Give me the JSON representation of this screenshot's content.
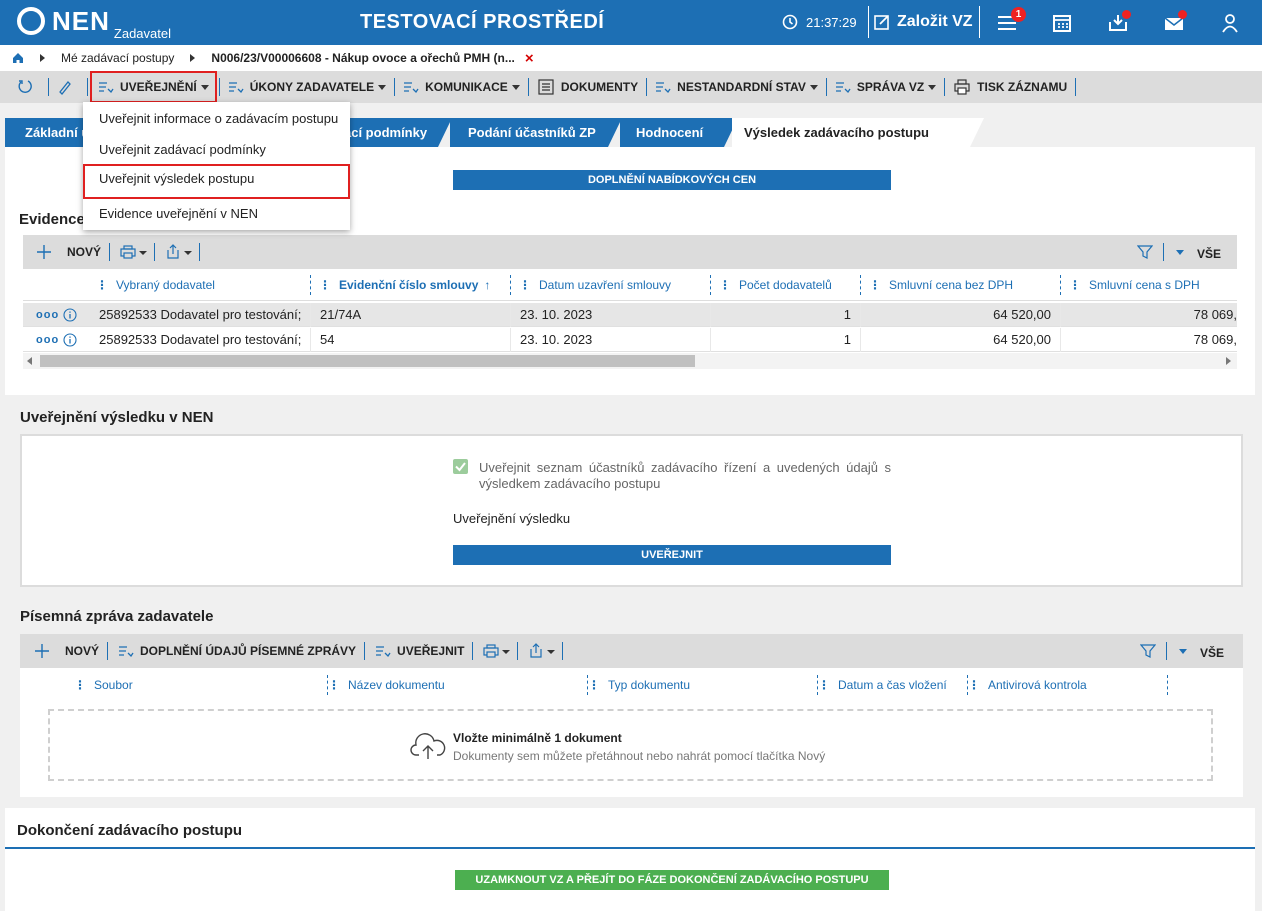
{
  "header": {
    "logo_text": "NEN",
    "logo_sub": "Zadavatel",
    "env_title": "TESTOVACÍ PROSTŘEDÍ",
    "time": "21:37:29",
    "create_label": "Založit VZ",
    "menu_badge": "1"
  },
  "breadcrumb": {
    "items": [
      "Mé zadávací postupy",
      "N006/23/V00006608 - Nákup ovoce a ořechů PMH (n..."
    ],
    "close": "×"
  },
  "toolbar": {
    "uverejneni": "UVEŘEJNĚNÍ",
    "ukony": "ÚKONY ZADAVATELE",
    "komunikace": "KOMUNIKACE",
    "dokumenty": "DOKUMENTY",
    "nestandardni": "NESTANDARDNÍ STAV",
    "sprava": "SPRÁVA VZ",
    "tisk": "TISK ZÁZNAMU"
  },
  "dropdown": {
    "items": [
      "Uveřejnit informace o zadávacím postupu",
      "Uveřejnit zadávací podmínky",
      "Uveřejnit výsledek postupu",
      "Evidence uveřejnění v NEN"
    ]
  },
  "tabs": [
    "Základní ú",
    "ací podmínky",
    "Podání účastníků ZP",
    "Hodnocení",
    "Výsledek zadávacího postupu"
  ],
  "section1": {
    "button": "DOPLNĚNÍ NABÍDKOVÝCH CEN",
    "title": "Evidence",
    "grid_new": "NOVÝ",
    "grid_all": "VŠE",
    "columns": [
      "Vybraný dodavatel",
      "Evidenční číslo smlouvy",
      "Datum uzavření smlouvy",
      "Počet dodavatelů",
      "Smluvní cena bez DPH",
      "Smluvní cena s DPH"
    ],
    "rows": [
      {
        "dodavatel": "25892533 Dodavatel pro testování;",
        "cislo": "21/74A",
        "datum": "23. 10. 2023",
        "pocet": "1",
        "bez_dph": "64 520,00",
        "s_dph": "78 069,"
      },
      {
        "dodavatel": "25892533 Dodavatel pro testování;",
        "cislo": "54",
        "datum": "23. 10. 2023",
        "pocet": "1",
        "bez_dph": "64 520,00",
        "s_dph": "78 069,"
      }
    ]
  },
  "section2": {
    "title": "Uveřejnění výsledku v NEN",
    "checkbox_label_1": "Uveřejnit seznam účastníků zadávacího řízení a uvedených údajů s",
    "checkbox_label_2": "výsledkem zadávacího postupu",
    "subheading": "Uveřejnění výsledku",
    "button": "UVEŘEJNIT"
  },
  "section3": {
    "title": "Písemná zpráva zadavatele",
    "new": "NOVÝ",
    "doplneni": "DOPLNĚNÍ ÚDAJŮ PÍSEMNÉ ZPRÁVY",
    "uverejnit": "UVEŘEJNIT",
    "all": "VŠE",
    "columns": [
      "Soubor",
      "Název dokumentu",
      "Typ dokumentu",
      "Datum a čas vložení",
      "Antivirová kontrola"
    ],
    "upload_title": "Vložte minimálně 1 dokument",
    "upload_hint": "Dokumenty sem můžete přetáhnout nebo nahrát pomocí tlačítka Nový"
  },
  "section4": {
    "title": "Dokončení zadávacího postupu",
    "button": "UZAMKNOUT VZ A PŘEJÍT DO FÁZE DOKONČENÍ ZADÁVACÍHO POSTUPU"
  },
  "colors": {
    "primary": "#1d6fb4",
    "green": "#4caf50",
    "alert": "#e02020"
  }
}
